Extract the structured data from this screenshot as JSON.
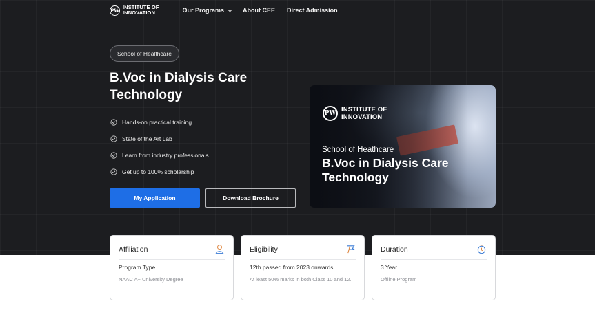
{
  "brand": {
    "mark": "PW",
    "line1": "INSTITUTE OF",
    "line2": "INNOVATION"
  },
  "nav": {
    "programs": "Our Programs",
    "about": "About CEE",
    "direct": "Direct Admission"
  },
  "hero": {
    "tag": "School of Healthcare",
    "title": "B.Voc in Dialysis Care Technology",
    "features": [
      "Hands-on practical training",
      "State of the Art Lab",
      "Learn from industry professionals",
      "Get up to 100% scholarship"
    ],
    "primary_button": "My Application",
    "secondary_button": "Download Brochure"
  },
  "banner": {
    "mark": "PW",
    "line1": "INSTITUTE OF",
    "line2": "INNOVATION",
    "school": "School of Heathcare",
    "title": "B.Voc in Dialysis Care Technology"
  },
  "cards": [
    {
      "heading": "Affiliation",
      "icon": "user-icon",
      "label": "Program Type",
      "value": "NAAC A+ University Degree"
    },
    {
      "heading": "Eligibility",
      "icon": "flag-icon",
      "label": "12th passed from 2023 onwards",
      "value": "At least 50% marks in both Class 10 and 12."
    },
    {
      "heading": "Duration",
      "icon": "timer-icon",
      "label": "3 Year",
      "value": "Offline Program"
    }
  ],
  "colors": {
    "accent": "#1e6ee6",
    "hero_bg": "#1c1d20",
    "icon_orange": "#e08a45",
    "icon_blue": "#3a7bd5"
  }
}
